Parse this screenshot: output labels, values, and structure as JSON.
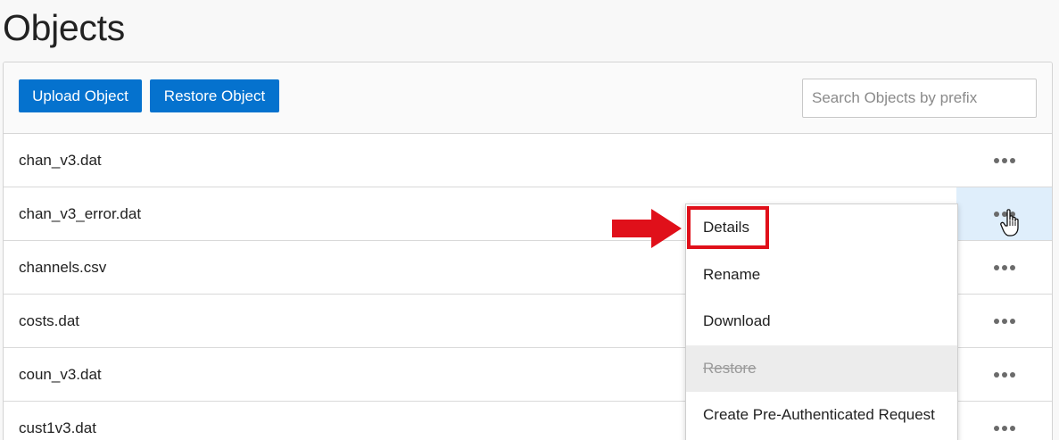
{
  "page": {
    "title": "Objects"
  },
  "toolbar": {
    "upload_label": "Upload Object",
    "restore_label": "Restore Object",
    "search_placeholder": "Search Objects by prefix"
  },
  "objects": [
    {
      "name": "chan_v3.dat"
    },
    {
      "name": "chan_v3_error.dat"
    },
    {
      "name": "channels.csv"
    },
    {
      "name": "costs.dat"
    },
    {
      "name": "coun_v3.dat"
    },
    {
      "name": "cust1v3.dat"
    }
  ],
  "context_menu": {
    "items": [
      {
        "label": "Details",
        "enabled": true
      },
      {
        "label": "Rename",
        "enabled": true
      },
      {
        "label": "Download",
        "enabled": true
      },
      {
        "label": "Restore",
        "enabled": false
      },
      {
        "label": "Create Pre-Authenticated Request",
        "enabled": true
      }
    ]
  },
  "colors": {
    "primary_button": "#0572ce",
    "annotation_red": "#e0101a",
    "active_row_actions": "#dfeefb"
  },
  "icons": {
    "row_actions": "more-horizontal-icon",
    "annotation": "red-arrow-icon",
    "pointer": "hand-cursor-icon"
  }
}
